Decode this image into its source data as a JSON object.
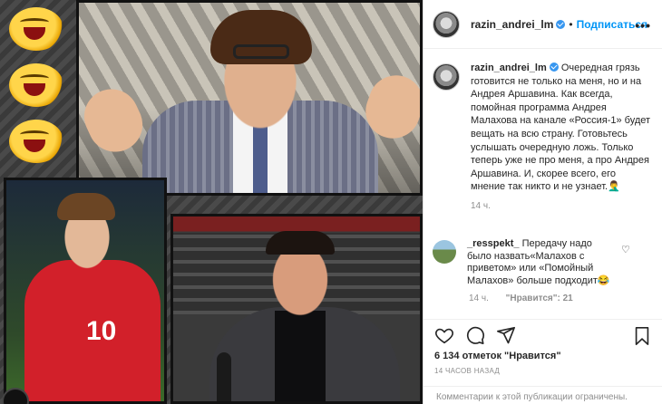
{
  "post_header": {
    "username": "razin_andrei_lm",
    "separator": "•",
    "follow_label": "Подписаться",
    "more_icon": "more-horizontal-icon"
  },
  "caption": {
    "username": "razin_andrei_lm",
    "text": "Очередная грязь готовится не только на меня, но и на Андрея Аршавина. Как всегда, помойная программа Андрея Малахова на канале «Россия-1» будет вещать на всю страну. Готовьтесь услышать очередную ложь. Только теперь уже не про меня, а про Андрея Аршавина. И, скорее всего, его мнение так никто и не узнает.🤦‍♂️",
    "time": "14 ч."
  },
  "comment": {
    "username": "_resspekt_",
    "text": "Передачу надо было назвать«Малахов с приветом» или «Помойный Малахов» больше подходит😂",
    "time": "14 ч.",
    "likes_text": "\"Нравится\": 21"
  },
  "actions": {
    "like_icon": "heart-icon",
    "comment_icon": "comment-icon",
    "share_icon": "send-icon",
    "save_icon": "bookmark-icon"
  },
  "likes_line": "6 134 отметок \"Нравится\"",
  "post_time": "14 ЧАСОВ НАЗАД",
  "comments_closed": "Комментарии к этой публикации ограничены.",
  "colors": {
    "link_blue": "#0095f6",
    "verified_blue": "#3897f0",
    "muted_text": "#8e8e8e"
  }
}
